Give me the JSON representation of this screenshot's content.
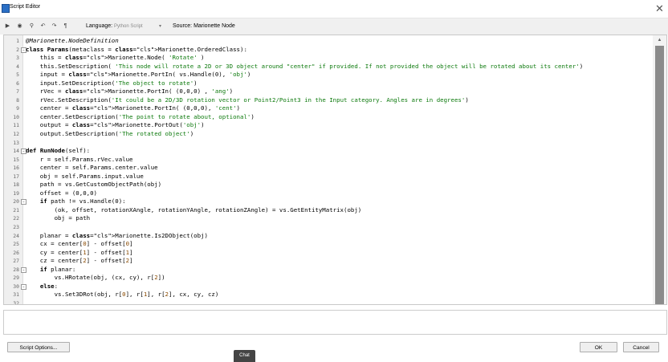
{
  "window": {
    "title": "Script Editor",
    "close_icon": "close-icon"
  },
  "toolbar": {
    "icons": [
      "run-icon",
      "stop-icon",
      "find-icon",
      "undo-icon",
      "redo-icon",
      "paragraph-icon"
    ],
    "language_label": "Language:",
    "language_value": "Python Script",
    "source_label": "Source: Marionette Node"
  },
  "editor": {
    "lines": [
      {
        "n": "1",
        "code": "@Marionette.NodeDefinition"
      },
      {
        "n": "2",
        "code": "class Params(metaclass = Marionette.OrderedClass):",
        "fold": true
      },
      {
        "n": "3",
        "code": "    this = Marionette.Node( 'Rotate' )"
      },
      {
        "n": "4",
        "code": "    this.SetDescription( 'This node will rotate a 2D or 3D object around \"center\" if provided. If not provided the object will be rotated about its center')"
      },
      {
        "n": "5",
        "code": "    input = Marionette.PortIn( vs.Handle(0), 'obj')"
      },
      {
        "n": "6",
        "code": "    input.SetDescription('The object to rotate')"
      },
      {
        "n": "7",
        "code": "    rVec = Marionette.PortIn( (0,0,0) , 'ang')"
      },
      {
        "n": "8",
        "code": "    rVec.SetDescription('It could be a 2D/3D rotation vector or Point2/Point3 in the Input category. Angles are in degrees')"
      },
      {
        "n": "9",
        "code": "    center = Marionette.PortIn( (0,0,0), 'cent')"
      },
      {
        "n": "10",
        "code": "    center.SetDescription('The point to rotate about, optional')"
      },
      {
        "n": "11",
        "code": "    output = Marionette.PortOut('obj')"
      },
      {
        "n": "12",
        "code": "    output.SetDescription('The rotated object')"
      },
      {
        "n": "13",
        "code": ""
      },
      {
        "n": "14",
        "code": "def RunNode(self):",
        "fold": true
      },
      {
        "n": "15",
        "code": "    r = self.Params.rVec.value"
      },
      {
        "n": "16",
        "code": "    center = self.Params.center.value"
      },
      {
        "n": "17",
        "code": "    obj = self.Params.input.value"
      },
      {
        "n": "18",
        "code": "    path = vs.GetCustomObjectPath(obj)"
      },
      {
        "n": "19",
        "code": "    offset = (0,0,0)"
      },
      {
        "n": "20",
        "code": "    if path != vs.Handle(0):",
        "fold": true
      },
      {
        "n": "21",
        "code": "        (ok, offset, rotationXAngle, rotationYAngle, rotationZAngle) = vs.GetEntityMatrix(obj)"
      },
      {
        "n": "22",
        "code": "        obj = path"
      },
      {
        "n": "23",
        "code": ""
      },
      {
        "n": "24",
        "code": "    planar = Marionette.Is2DObject(obj)"
      },
      {
        "n": "25",
        "code": "    cx = center[0] - offset[0]"
      },
      {
        "n": "26",
        "code": "    cy = center[1] - offset[1]"
      },
      {
        "n": "27",
        "code": "    cz = center[2] - offset[2]"
      },
      {
        "n": "28",
        "code": "    if planar:",
        "fold": true
      },
      {
        "n": "29",
        "code": "        vs.HRotate(obj, (cx, cy), r[2])"
      },
      {
        "n": "30",
        "code": "    else:",
        "fold": true
      },
      {
        "n": "31",
        "code": "        vs.Set3DRot(obj, r[0], r[1], r[2], cx, cy, cz)"
      },
      {
        "n": "32",
        "code": ""
      }
    ]
  },
  "footer": {
    "script_options_label": "Script Options...",
    "ok_label": "OK",
    "cancel_label": "Cancel",
    "chat_label": "Chat"
  }
}
